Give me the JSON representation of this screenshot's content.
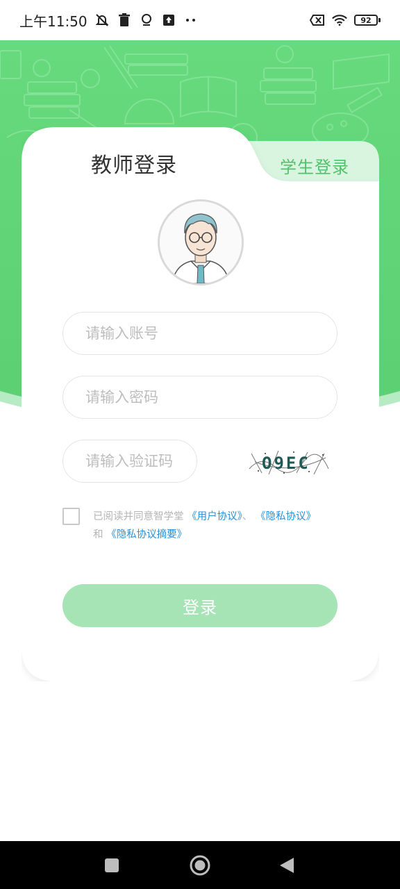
{
  "status_bar": {
    "time": "上午11:50",
    "battery": "92",
    "icons": [
      "notifications-off-icon",
      "trash-icon",
      "location-icon",
      "upload-icon",
      "more-dots-icon",
      "sim-off-icon",
      "wifi-icon",
      "battery-icon"
    ]
  },
  "tabs": {
    "teacher": "教师登录",
    "student": "学生登录"
  },
  "form": {
    "account_placeholder": "请输入账号",
    "password_placeholder": "请输入密码",
    "captcha_placeholder": "请输入验证码",
    "captcha_text": "O9EC"
  },
  "agreement": {
    "prefix": "已阅读并同意智学堂",
    "user_agreement": "《用户协议》",
    "separator": "、",
    "privacy_policy": "《隐私协议》",
    "and": "和",
    "privacy_summary": "《隐私协议摘要》"
  },
  "login_button": "登录",
  "colors": {
    "brand_green": "#4fc36b",
    "header_green": "#5ed474",
    "button_disabled": "#a6e3b5",
    "link_blue": "#2b8fd6"
  }
}
